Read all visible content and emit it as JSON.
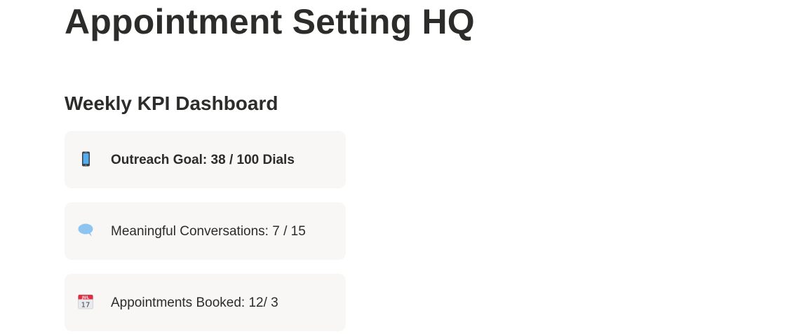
{
  "page": {
    "title": "Appointment Setting HQ"
  },
  "dashboard": {
    "heading": "Weekly KPI Dashboard",
    "cards": [
      {
        "icon": "mobile-phone-icon",
        "text": "Outreach Goal: 38 / 100 Dials",
        "bold": true
      },
      {
        "icon": "speech-bubble-icon",
        "text": "Meaningful Conversations: 7 / 15",
        "bold": false
      },
      {
        "icon": "calendar-icon",
        "text": "Appointments Booked: 12/ 3",
        "bold": false
      }
    ],
    "calendar_icon_month": "JUL",
    "calendar_icon_day": "17"
  }
}
